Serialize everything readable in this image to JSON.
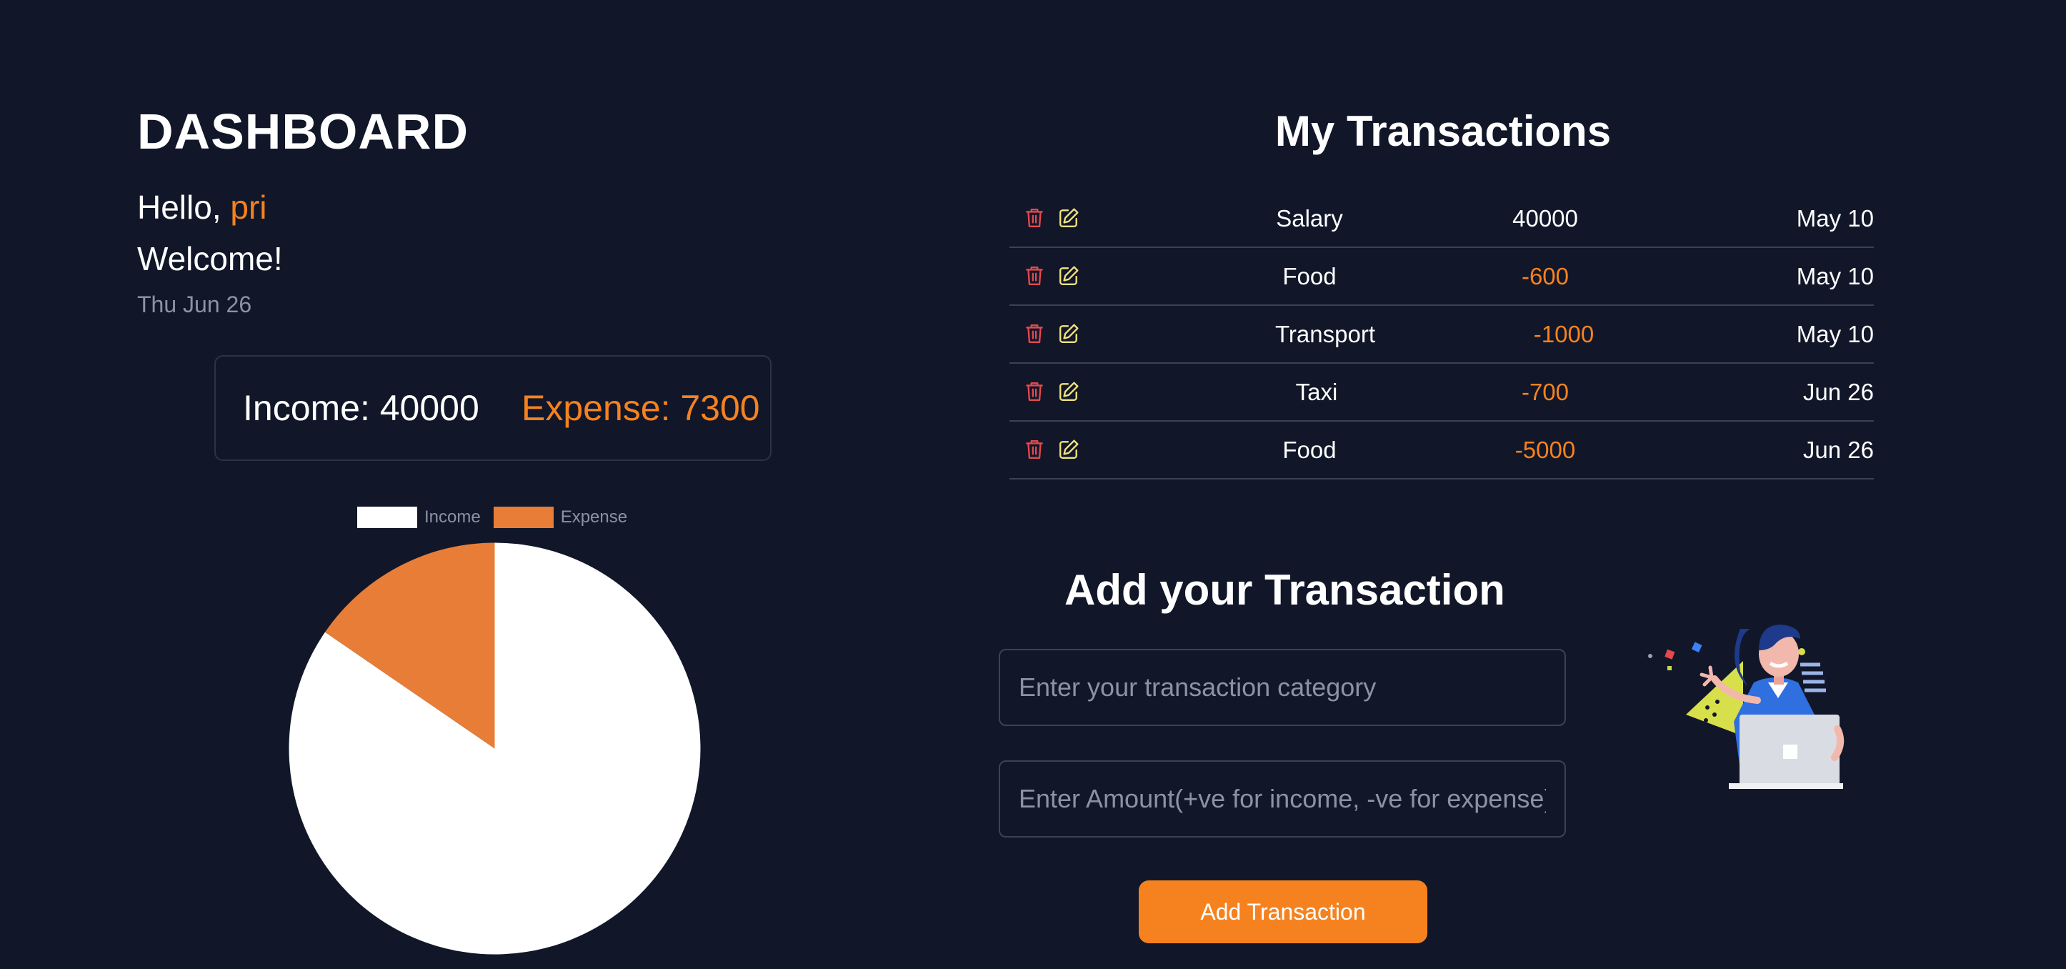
{
  "dashboard": {
    "title": "DASHBOARD",
    "greeting_prefix": "Hello, ",
    "user_name": "pri",
    "welcome": "Welcome!",
    "date": "Thu Jun 26",
    "income_label": "Income: 40000",
    "expense_label": "Expense: 7300"
  },
  "chart_data": {
    "type": "pie",
    "categories": [
      "Income",
      "Expense"
    ],
    "values": [
      40000,
      7300
    ],
    "colors": [
      "#ffffff",
      "#e87d38"
    ],
    "legend": "top",
    "title": ""
  },
  "transactions": {
    "title": "My Transactions",
    "rows": [
      {
        "category": "Salary",
        "amount": "40000",
        "date": "May 10",
        "type": "income"
      },
      {
        "category": "Food",
        "amount": "-600",
        "date": "May 10",
        "type": "expense"
      },
      {
        "category": "Transport",
        "amount": "-1000",
        "date": "May 10",
        "type": "expense"
      },
      {
        "category": "Taxi",
        "amount": "-700",
        "date": "Jun 26",
        "type": "expense"
      },
      {
        "category": "Food",
        "amount": "-5000",
        "date": "Jun 26",
        "type": "expense"
      }
    ],
    "row_icons": [
      "trash-icon",
      "edit-icon"
    ]
  },
  "add_form": {
    "title": "Add your Transaction",
    "category_placeholder": "Enter your transaction category",
    "amount_placeholder": "Enter Amount(+ve for income, -ve for expense)",
    "button_label": "Add Transaction"
  },
  "colors": {
    "background": "#111729",
    "accent": "#f5821f",
    "delete": "#e5484d",
    "edit": "#f2e27d",
    "muted": "#8b93a3",
    "border": "#3a4354"
  }
}
